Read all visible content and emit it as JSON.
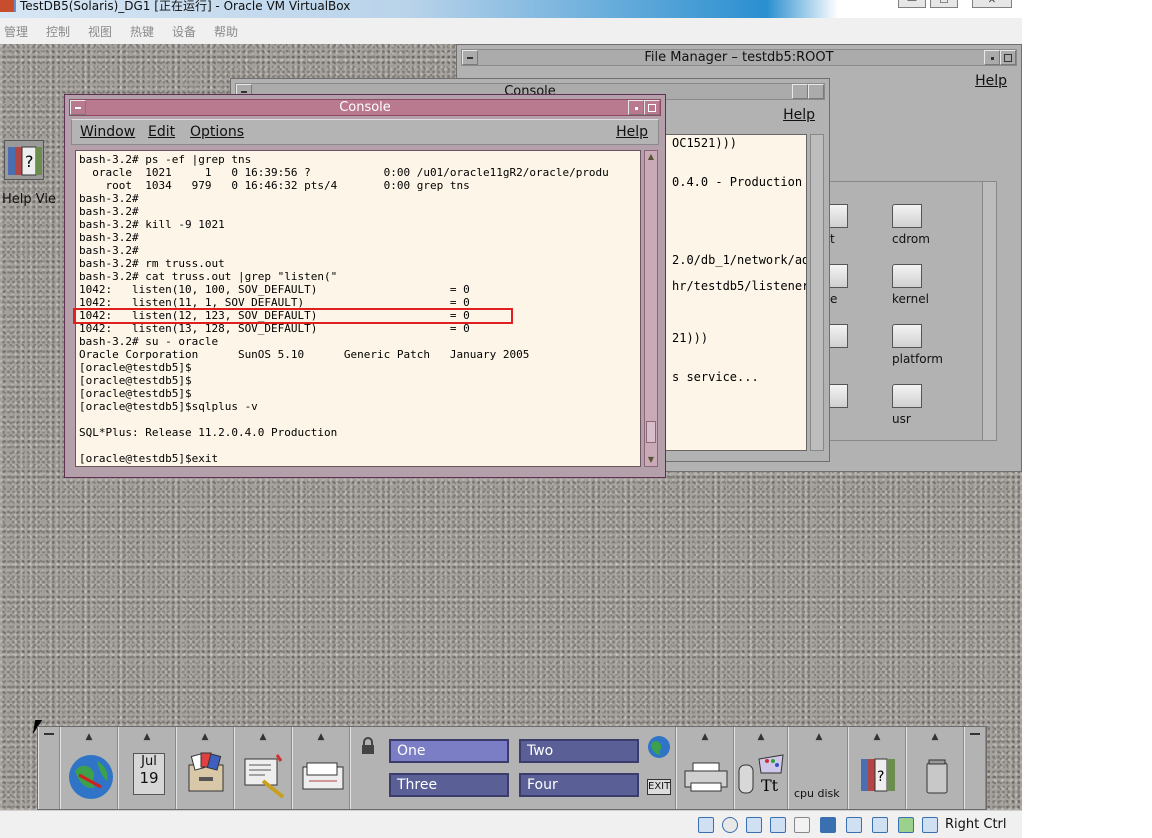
{
  "host_window": {
    "title": "TestDB5(Solaris)_DG1 [正在运行] - Oracle VM VirtualBox",
    "menu": [
      "管理",
      "控制",
      "视图",
      "热键",
      "设备",
      "帮助"
    ],
    "host_key_label": "Right Ctrl"
  },
  "desktop": {
    "help_viewer_label": "Help Vie"
  },
  "file_manager": {
    "title": "File Manager – testdb5:ROOT",
    "help_label": "Help",
    "folders": [
      {
        "label": "t"
      },
      {
        "label": "cdrom"
      },
      {
        "label": "e"
      },
      {
        "label": "kernel"
      },
      {
        "label": "platform"
      },
      {
        "label": "usr"
      }
    ]
  },
  "console_back": {
    "title": "Console",
    "help_label": "Help",
    "visible_lines": "OC1521)))\n\n\n0.4.0 - Production\n\n\n\n\n\n2.0/db_1/network/ad\n\nhr/testdb5/listener/\n\n\n\n21)))\n\n\ns service..."
  },
  "console": {
    "title": "Console",
    "menu": {
      "window": "Window",
      "edit": "Edit",
      "options": "Options",
      "help": "Help"
    },
    "terminal_text": "bash-3.2# ps -ef |grep tns\n  oracle  1021     1   0 16:39:56 ?           0:00 /u01/oracle11gR2/oracle/produ\n    root  1034   979   0 16:46:32 pts/4       0:00 grep tns\nbash-3.2#\nbash-3.2#\nbash-3.2# kill -9 1021\nbash-3.2#\nbash-3.2#\nbash-3.2# rm truss.out\nbash-3.2# cat truss.out |grep \"listen(\"\n1042:   listen(10, 100, SOV_DEFAULT)                    = 0\n1042:   listen(11, 1, SOV_DEFAULT)                      = 0\n1042:   listen(12, 123, SOV_DEFAULT)                    = 0\n1042:   listen(13, 128, SOV_DEFAULT)                    = 0\nbash-3.2# su - oracle\nOracle Corporation      SunOS 5.10      Generic Patch   January 2005\n[oracle@testdb5]$\n[oracle@testdb5]$\n[oracle@testdb5]$\n[oracle@testdb5]$sqlplus -v\n\nSQL*Plus: Release 11.2.0.4.0 Production\n\n[oracle@testdb5]$exit"
  },
  "front_panel": {
    "calendar_month": "Jul",
    "calendar_day": "19",
    "workspaces": [
      "One",
      "Two",
      "Three",
      "Four"
    ],
    "exit_label": "EXIT",
    "cpu_disk_label": "cpu disk"
  }
}
